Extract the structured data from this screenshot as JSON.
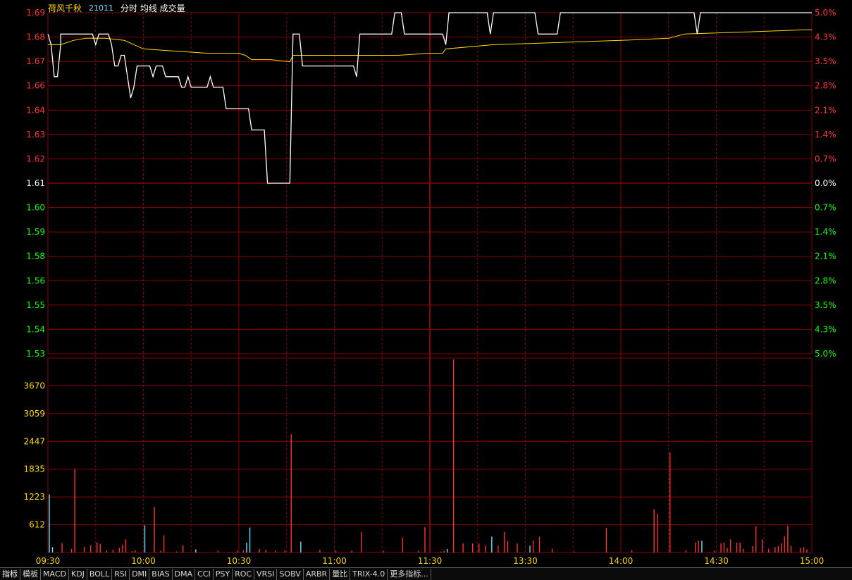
{
  "header": {
    "name": "荷风千秋",
    "code": "21011",
    "legend": "分时 均线 成交量"
  },
  "colors": {
    "grid": "#8b0000",
    "grid_dash": "#8b0000",
    "price_line": "#ffffff",
    "avg_line": "#ffd700",
    "up_label": "#ff3030",
    "down_label": "#00ff00",
    "base_label": "#ffffff",
    "vol_label": "#ffd700",
    "vol_up": "#ff3030",
    "vol_down": "#66e0ff",
    "time_label": "#ffd700"
  },
  "tabs": [
    "指标",
    "模板",
    "MACD",
    "KDJ",
    "BOLL",
    "RSI",
    "DMI",
    "BIAS",
    "DMA",
    "CCI",
    "PSY",
    "ROC",
    "VRSI",
    "SOBV",
    "ARBR",
    "量比",
    "TRIX-4.0",
    "更多指标..."
  ],
  "chart_data": {
    "type": "line",
    "base_price": 1.61,
    "price_axis": {
      "min": 1.53,
      "max": 1.69,
      "labels": [
        {
          "v": 1.69,
          "t": "1.69",
          "pct": "5.0%"
        },
        {
          "v": 1.68,
          "t": "1.68",
          "pct": "4.3%"
        },
        {
          "v": 1.67,
          "t": "1.67",
          "pct": "3.5%"
        },
        {
          "v": 1.66,
          "t": "1.66",
          "pct": "2.8%"
        },
        {
          "v": 1.65,
          "t": "1.64",
          "pct": "2.1%"
        },
        {
          "v": 1.64,
          "t": "1.63",
          "pct": "1.4%"
        },
        {
          "v": 1.62,
          "t": "1.62",
          "pct": "0.7%"
        },
        {
          "v": 1.61,
          "t": "1.61",
          "pct": "0.0%"
        },
        {
          "v": 1.6,
          "t": "1.60",
          "pct": "0.7%"
        },
        {
          "v": 1.59,
          "t": "1.59",
          "pct": "1.4%"
        },
        {
          "v": 1.58,
          "t": "1.58",
          "pct": "2.1%"
        },
        {
          "v": 1.57,
          "t": "1.56",
          "pct": "2.8%"
        },
        {
          "v": 1.56,
          "t": "1.55",
          "pct": "3.5%"
        },
        {
          "v": 1.54,
          "t": "1.54",
          "pct": "4.3%"
        },
        {
          "v": 1.53,
          "t": "1.53",
          "pct": "5.0%"
        }
      ]
    },
    "volume_axis": {
      "min": 0,
      "max": 4282,
      "labels": [
        3670,
        3059,
        2447,
        1835,
        1223,
        612
      ]
    },
    "time_labels": [
      {
        "m": 0,
        "t": "09:30"
      },
      {
        "m": 30,
        "t": "10:00"
      },
      {
        "m": 60,
        "t": "10:30"
      },
      {
        "m": 90,
        "t": "11:00"
      },
      {
        "m": 120,
        "t": "11:30"
      },
      {
        "m": 150,
        "t": "13:30"
      },
      {
        "m": 180,
        "t": "14:00"
      },
      {
        "m": 210,
        "t": "14:30"
      },
      {
        "m": 240,
        "t": "15:00"
      }
    ],
    "price_points": [
      [
        0,
        1.68
      ],
      [
        1,
        1.675
      ],
      [
        2,
        1.66
      ],
      [
        3,
        1.66
      ],
      [
        4,
        1.675
      ],
      [
        4,
        1.68
      ],
      [
        10,
        1.68
      ],
      [
        14,
        1.68
      ],
      [
        15,
        1.675
      ],
      [
        16,
        1.68
      ],
      [
        19,
        1.68
      ],
      [
        20,
        1.675
      ],
      [
        21,
        1.665
      ],
      [
        22,
        1.665
      ],
      [
        23,
        1.67
      ],
      [
        24,
        1.67
      ],
      [
        25,
        1.66
      ],
      [
        26,
        1.65
      ],
      [
        27,
        1.655
      ],
      [
        28,
        1.665
      ],
      [
        32,
        1.665
      ],
      [
        33,
        1.66
      ],
      [
        34,
        1.665
      ],
      [
        36,
        1.665
      ],
      [
        37,
        1.66
      ],
      [
        41,
        1.66
      ],
      [
        42,
        1.655
      ],
      [
        43,
        1.655
      ],
      [
        44,
        1.66
      ],
      [
        45,
        1.655
      ],
      [
        50,
        1.655
      ],
      [
        51,
        1.66
      ],
      [
        52,
        1.655
      ],
      [
        55,
        1.655
      ],
      [
        56,
        1.645
      ],
      [
        63,
        1.645
      ],
      [
        64,
        1.635
      ],
      [
        68,
        1.635
      ],
      [
        69,
        1.61
      ],
      [
        76,
        1.61
      ],
      [
        77,
        1.68
      ],
      [
        79,
        1.68
      ],
      [
        80,
        1.665
      ],
      [
        96,
        1.665
      ],
      [
        97,
        1.66
      ],
      [
        98,
        1.68
      ],
      [
        108,
        1.68
      ],
      [
        109,
        1.69
      ],
      [
        111,
        1.69
      ],
      [
        112,
        1.68
      ],
      [
        119,
        1.68
      ],
      [
        120,
        1.68
      ],
      [
        124,
        1.68
      ],
      [
        125,
        1.675
      ],
      [
        126,
        1.69
      ],
      [
        138,
        1.69
      ],
      [
        139,
        1.68
      ],
      [
        140,
        1.69
      ],
      [
        153,
        1.69
      ],
      [
        154,
        1.68
      ],
      [
        160,
        1.68
      ],
      [
        161,
        1.69
      ],
      [
        203,
        1.69
      ],
      [
        204,
        1.68
      ],
      [
        205,
        1.69
      ],
      [
        240,
        1.69
      ]
    ],
    "avg_points": [
      [
        0,
        1.675
      ],
      [
        1,
        1.675
      ],
      [
        4,
        1.675
      ],
      [
        8,
        1.677
      ],
      [
        12,
        1.678
      ],
      [
        18,
        1.678
      ],
      [
        24,
        1.677
      ],
      [
        30,
        1.673
      ],
      [
        40,
        1.672
      ],
      [
        50,
        1.671
      ],
      [
        60,
        1.671
      ],
      [
        62,
        1.67
      ],
      [
        64,
        1.668
      ],
      [
        70,
        1.668
      ],
      [
        76,
        1.667
      ],
      [
        77,
        1.67
      ],
      [
        80,
        1.67
      ],
      [
        96,
        1.67
      ],
      [
        110,
        1.67
      ],
      [
        120,
        1.671
      ],
      [
        124,
        1.671
      ],
      [
        125,
        1.673
      ],
      [
        140,
        1.675
      ],
      [
        160,
        1.676
      ],
      [
        180,
        1.677
      ],
      [
        195,
        1.678
      ],
      [
        200,
        1.68
      ],
      [
        220,
        1.681
      ],
      [
        238,
        1.682
      ],
      [
        240,
        1.682
      ]
    ],
    "volume_bars": [
      [
        0,
        1280,
        "down"
      ],
      [
        1,
        120,
        "down"
      ],
      [
        4,
        210,
        "up"
      ],
      [
        7,
        80,
        "up"
      ],
      [
        8,
        1830,
        "up"
      ],
      [
        11,
        120,
        "up"
      ],
      [
        13,
        160,
        "up"
      ],
      [
        15,
        220,
        "up"
      ],
      [
        16,
        190,
        "up"
      ],
      [
        18,
        40,
        "up"
      ],
      [
        20,
        60,
        "up"
      ],
      [
        22,
        100,
        "up"
      ],
      [
        23,
        170,
        "up"
      ],
      [
        24,
        290,
        "up"
      ],
      [
        26,
        30,
        "up"
      ],
      [
        27,
        50,
        "up"
      ],
      [
        30,
        600,
        "down"
      ],
      [
        33,
        1000,
        "up"
      ],
      [
        35,
        40,
        "up"
      ],
      [
        36,
        380,
        "up"
      ],
      [
        40,
        20,
        "up"
      ],
      [
        42,
        160,
        "up"
      ],
      [
        46,
        70,
        "down"
      ],
      [
        53,
        40,
        "up"
      ],
      [
        59,
        40,
        "up"
      ],
      [
        61,
        50,
        "up"
      ],
      [
        62,
        220,
        "down"
      ],
      [
        63,
        550,
        "down"
      ],
      [
        66,
        80,
        "up"
      ],
      [
        68,
        60,
        "up"
      ],
      [
        71,
        40,
        "up"
      ],
      [
        74,
        40,
        "up"
      ],
      [
        76,
        2600,
        "up"
      ],
      [
        79,
        240,
        "down"
      ],
      [
        85,
        60,
        "up"
      ],
      [
        90,
        40,
        "up"
      ],
      [
        95,
        40,
        "up"
      ],
      [
        98,
        450,
        "up"
      ],
      [
        105,
        30,
        "up"
      ],
      [
        111,
        330,
        "up"
      ],
      [
        116,
        40,
        "up"
      ],
      [
        118,
        560,
        "up"
      ],
      [
        123,
        20,
        "up"
      ],
      [
        124,
        40,
        "up"
      ],
      [
        125,
        80,
        "down"
      ],
      [
        127,
        4250,
        "up"
      ],
      [
        130,
        200,
        "up"
      ],
      [
        133,
        200,
        "up"
      ],
      [
        135,
        200,
        "up"
      ],
      [
        137,
        150,
        "up"
      ],
      [
        139,
        350,
        "down"
      ],
      [
        141,
        150,
        "up"
      ],
      [
        143,
        450,
        "up"
      ],
      [
        144,
        250,
        "up"
      ],
      [
        147,
        200,
        "up"
      ],
      [
        151,
        150,
        "down"
      ],
      [
        152,
        260,
        "up"
      ],
      [
        154,
        350,
        "up"
      ],
      [
        158,
        80,
        "up"
      ],
      [
        165,
        20,
        "up"
      ],
      [
        175,
        540,
        "up"
      ],
      [
        183,
        50,
        "up"
      ],
      [
        190,
        950,
        "up"
      ],
      [
        191,
        850,
        "up"
      ],
      [
        195,
        2200,
        "up"
      ],
      [
        200,
        50,
        "up"
      ],
      [
        203,
        220,
        "up"
      ],
      [
        204,
        260,
        "up"
      ],
      [
        205,
        260,
        "down"
      ],
      [
        209,
        40,
        "up"
      ],
      [
        211,
        200,
        "up"
      ],
      [
        212,
        220,
        "up"
      ],
      [
        213,
        100,
        "up"
      ],
      [
        214,
        290,
        "up"
      ],
      [
        216,
        220,
        "up"
      ],
      [
        217,
        220,
        "up"
      ],
      [
        218,
        80,
        "up"
      ],
      [
        221,
        140,
        "up"
      ],
      [
        222,
        580,
        "up"
      ],
      [
        224,
        290,
        "up"
      ],
      [
        226,
        80,
        "up"
      ],
      [
        228,
        120,
        "up"
      ],
      [
        229,
        140,
        "up"
      ],
      [
        230,
        200,
        "up"
      ],
      [
        231,
        360,
        "up"
      ],
      [
        232,
        590,
        "up"
      ],
      [
        233,
        150,
        "up"
      ],
      [
        236,
        100,
        "up"
      ],
      [
        237,
        120,
        "up"
      ],
      [
        238,
        70,
        "up"
      ]
    ]
  }
}
